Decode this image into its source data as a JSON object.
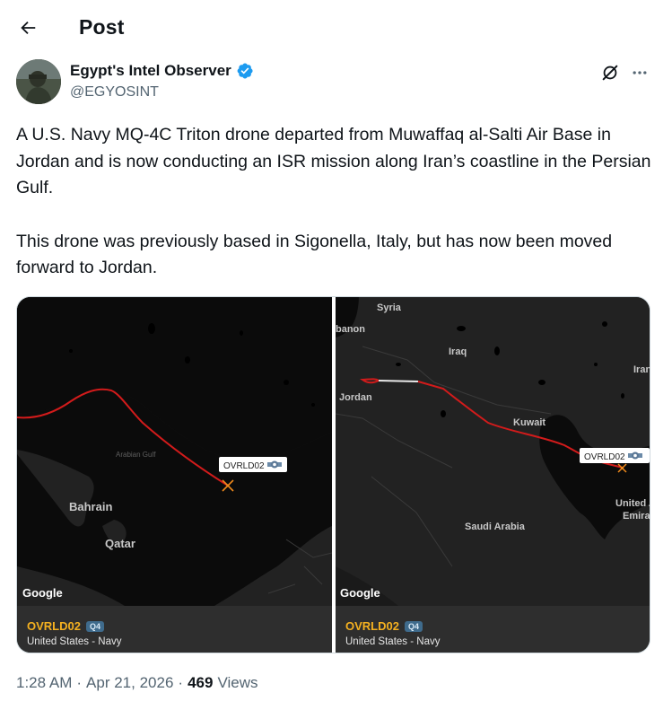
{
  "header": {
    "title": "Post"
  },
  "author": {
    "name": "Egypt's Intel Observer",
    "handle": "@EGYOSINT",
    "verified": true
  },
  "post": {
    "paragraphs": [
      "A U.S. Navy MQ-4C Triton drone departed from Muwaffaq al-Salti Air Base in Jordan and is now conducting an ISR mission along Iran’s coastline in the Persian Gulf.",
      "This drone was previously based in Sigonella, Italy, but has now been moved forward to Jordan."
    ]
  },
  "media": [
    {
      "map_labels": {
        "gulf": "Arabian Gulf",
        "bahrain": "Bahrain",
        "qatar": "Qatar",
        "marker": "OVRLD02",
        "google": "Google"
      },
      "callsign": "OVRLD02",
      "badge": "Q4",
      "operator": "United States - Navy"
    },
    {
      "map_labels": {
        "syria": "Syria",
        "lebanon": "banon",
        "iraq": "Iraq",
        "iran": "Iran",
        "jordan": "Jordan",
        "kuwait": "Kuwait",
        "saudi": "Saudi Arabia",
        "uae1": "United A",
        "uae2": "Emirat",
        "marker": "OVRLD02",
        "google": "Google"
      },
      "callsign": "OVRLD02",
      "badge": "Q4",
      "operator": "United States - Navy"
    }
  ],
  "meta": {
    "time": "1:28 AM",
    "date": "Apr 21, 2026",
    "views_count": "469",
    "views_label": "Views"
  },
  "colors": {
    "track": "#d21b1b",
    "callsign": "#f5b120",
    "verified": "#1d9bf0",
    "map_land": "#222222",
    "map_sea": "#0b0b0b"
  },
  "icons": [
    "back-arrow-icon",
    "verified-badge-icon",
    "grok-icon",
    "more-icon",
    "aircraft-icon"
  ]
}
